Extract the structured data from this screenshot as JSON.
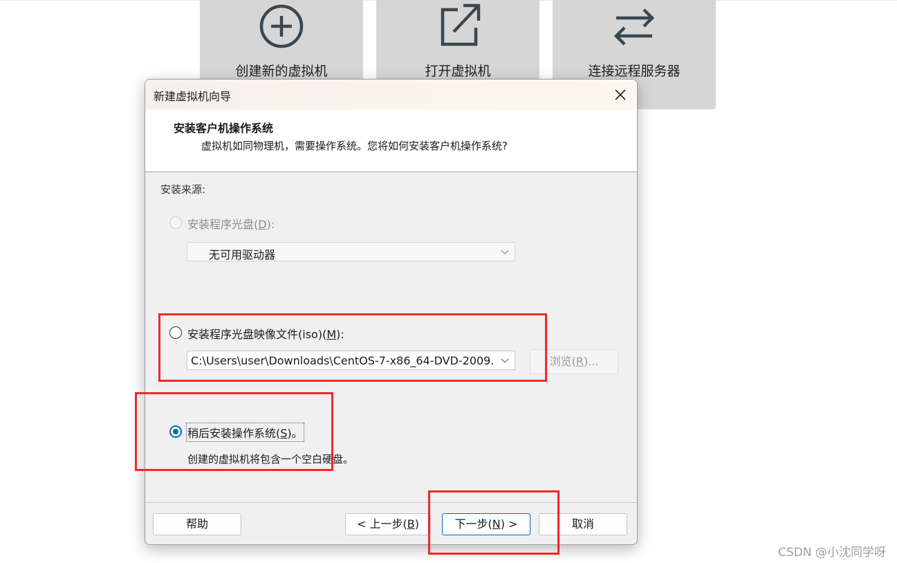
{
  "home_tiles": [
    {
      "label": "创建新的虚拟机",
      "icon": "plus-circle-icon"
    },
    {
      "label": "打开虚拟机",
      "icon": "open-external-icon"
    },
    {
      "label": "连接远程服务器",
      "icon": "swap-arrows-icon"
    }
  ],
  "dialog": {
    "title": "新建虚拟机向导",
    "heading": "安装客户机操作系统",
    "subheading": "虚拟机如同物理机，需要操作系统。您将如何安装客户机操作系统?",
    "source_label": "安装来源:",
    "option_disc": {
      "prefix": "安装程序光盘(",
      "key": "D",
      "suffix": "):"
    },
    "disc_drive_value": "无可用驱动器",
    "option_iso": {
      "prefix": "安装程序光盘映像文件(iso)(",
      "key": "M",
      "suffix": "):"
    },
    "iso_path_value": "C:\\Users\\user\\Downloads\\CentOS-7-x86_64-DVD-2009.",
    "browse": {
      "prefix": "浏览(",
      "key": "R",
      "suffix": ")..."
    },
    "option_later": {
      "prefix": "稍后安装操作系统(",
      "key": "S",
      "suffix": ")。"
    },
    "later_desc": "创建的虚拟机将包含一个空白硬盘。",
    "buttons": {
      "help": "帮助",
      "back": {
        "prefix": "< 上一步(",
        "key": "B",
        "suffix": ")"
      },
      "next": {
        "prefix": "下一步(",
        "key": "N",
        "suffix": ") >"
      },
      "cancel": "取消"
    }
  },
  "watermark": "CSDN @小沈同学呀",
  "colors": {
    "accent": "#0067c0",
    "highlight_box": "#f2272a",
    "tile_bg": "#d6d6d6",
    "icon_color": "#3a4750"
  }
}
